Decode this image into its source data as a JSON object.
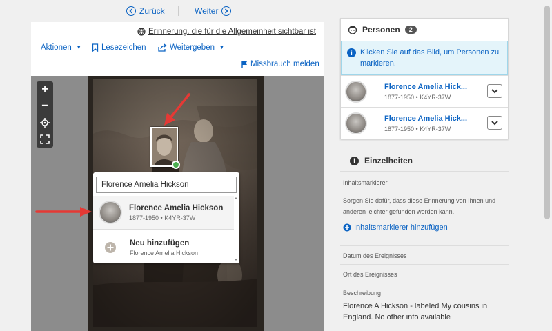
{
  "nav": {
    "back_label": "Zurück",
    "next_label": "Weiter"
  },
  "header": {
    "visibility_text": "Erinnerung, die für die Allgemeinheit sichtbar ist",
    "actions_label": "Aktionen",
    "bookmark_label": "Lesezeichen",
    "share_label": "Weitergeben",
    "report_label": "Missbrauch melden"
  },
  "viewer": {
    "zoom_in": "+",
    "zoom_out": "−"
  },
  "popup": {
    "search_value": "Florence Amelia Hickson",
    "match": {
      "name": "Florence Amelia Hickson",
      "sub": "1877-1950 • K4YR-37W"
    },
    "add_new": {
      "label": "Neu hinzufügen",
      "sub": "Florence Amelia Hickson"
    }
  },
  "persons": {
    "title": "Personen",
    "count": "2",
    "info": "Klicken Sie auf das Bild, um Personen zu markieren.",
    "items": [
      {
        "name": "Florence Amelia Hick...",
        "sub": "1877-1950 • K4YR-37W"
      },
      {
        "name": "Florence Amelia Hick...",
        "sub": "1877-1950 • K4YR-37W"
      }
    ]
  },
  "details": {
    "title": "Einzelheiten",
    "tags_label": "Inhaltsmarkierer",
    "tags_text": "Sorgen Sie dafür, dass diese Erinnerung von Ihnen und anderen leichter gefunden werden kann.",
    "tags_add": "Inhaltsmarkierer hinzufügen",
    "date_label": "Datum des Ereignisses",
    "place_label": "Ort des Ereignisses",
    "desc_label": "Beschreibung",
    "desc_text": "Florence A Hickson - labeled My cousins in England. No other info available"
  },
  "colors": {
    "link": "#0b63c3",
    "info_bg": "#e4f4fa",
    "arrow": "#e53935",
    "tag_dot": "#4caf50"
  }
}
